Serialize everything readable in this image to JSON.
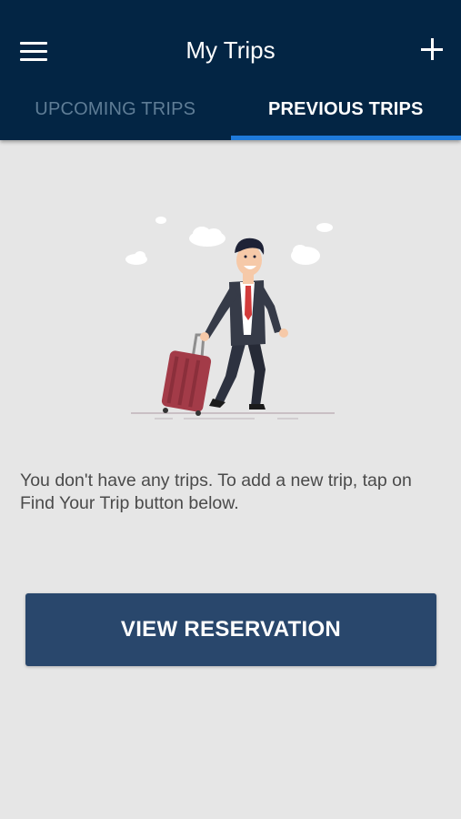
{
  "header": {
    "title": "My Trips",
    "menu_icon": "hamburger-menu-icon",
    "add_icon": "plus-icon"
  },
  "tabs": [
    {
      "label": "UPCOMING TRIPS",
      "active": false
    },
    {
      "label": "PREVIOUS TRIPS",
      "active": true
    }
  ],
  "empty_state": {
    "illustration": "businessman-with-suitcase-illustration",
    "message": "You don't have any trips. To add a new trip, tap on Find Your Trip button below."
  },
  "cta": {
    "label": "VIEW RESERVATION"
  },
  "colors": {
    "header_bg": "#032544",
    "tab_indicator": "#1f7ad9",
    "button_bg": "#29476c",
    "page_bg": "#e6e6e6"
  }
}
